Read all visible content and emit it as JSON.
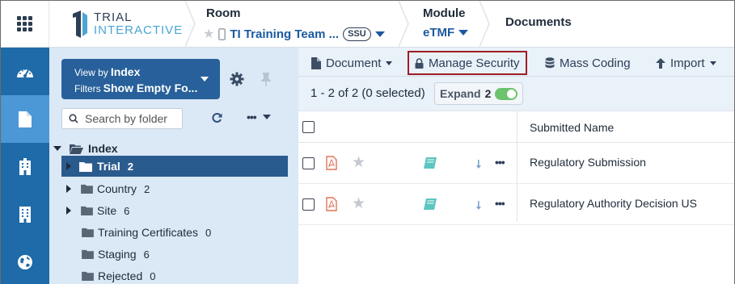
{
  "header": {
    "logo_line1": "TRIAL",
    "logo_line2": "INTERACTIVE",
    "room_title": "Room",
    "room_value": "TI Training Team ...",
    "room_badge": "SSU",
    "module_title": "Module",
    "module_value": "eTMF",
    "page_title": "Documents"
  },
  "leftnav": {
    "items": [
      {
        "icon": "dashboard-icon"
      },
      {
        "icon": "document-icon",
        "active": true
      },
      {
        "icon": "building-icon"
      },
      {
        "icon": "office-building-icon"
      },
      {
        "icon": "globe-icon"
      }
    ]
  },
  "folders": {
    "viewby_label": "View by",
    "viewby_value": "Index",
    "filters_label": "Filters",
    "filters_value": "Show Empty Fo...",
    "search_placeholder": "Search by folder",
    "tree": [
      {
        "label": "Index",
        "count": "",
        "level": 0,
        "expanded": true
      },
      {
        "label": "Trial",
        "count": "2",
        "level": 1,
        "selected": true,
        "expandable": true
      },
      {
        "label": "Country",
        "count": "2",
        "level": 1,
        "expandable": true
      },
      {
        "label": "Site",
        "count": "6",
        "level": 1,
        "expandable": true
      },
      {
        "label": "Training Certificates",
        "count": "0",
        "level": 1
      },
      {
        "label": "Staging",
        "count": "6",
        "level": 1
      },
      {
        "label": "Rejected",
        "count": "0",
        "level": 1
      }
    ]
  },
  "toolbar": {
    "document_label": "Document",
    "manage_security_label": "Manage Security",
    "mass_coding_label": "Mass Coding",
    "import_label": "Import"
  },
  "info": {
    "count_text": "1 - 2 of 2 (0 selected)",
    "expand_label": "Expand",
    "expand_count": "2"
  },
  "table": {
    "column_header": "Submitted Name",
    "rows": [
      {
        "name": "Regulatory Submission"
      },
      {
        "name": "Regulatory Authority Decision US"
      }
    ]
  },
  "colors": {
    "nav_bg": "#1f6aa8",
    "nav_active": "#4c97d6",
    "panel_bg": "#dbe8f5",
    "selected_folder": "#2a5b8e",
    "highlight_border": "#9c1e27",
    "link_blue": "#1c5aa0",
    "toggle_green": "#6cc36e"
  }
}
